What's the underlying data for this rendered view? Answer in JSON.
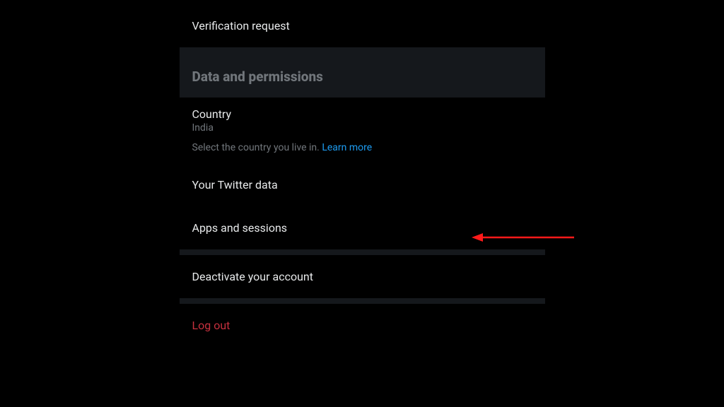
{
  "items": {
    "verification_request": "Verification request",
    "your_twitter_data": "Your Twitter data",
    "apps_and_sessions": "Apps and sessions",
    "deactivate": "Deactivate your account",
    "logout": "Log out"
  },
  "section": {
    "data_permissions": "Data and permissions"
  },
  "country": {
    "title": "Country",
    "value": "India",
    "description": "Select the country you live in. ",
    "learn_more": "Learn more"
  },
  "colors": {
    "link": "#1d9bf0",
    "danger": "#c6303e",
    "text": "#e7e9ea",
    "muted": "#71767b",
    "section_bg": "#15181c"
  }
}
